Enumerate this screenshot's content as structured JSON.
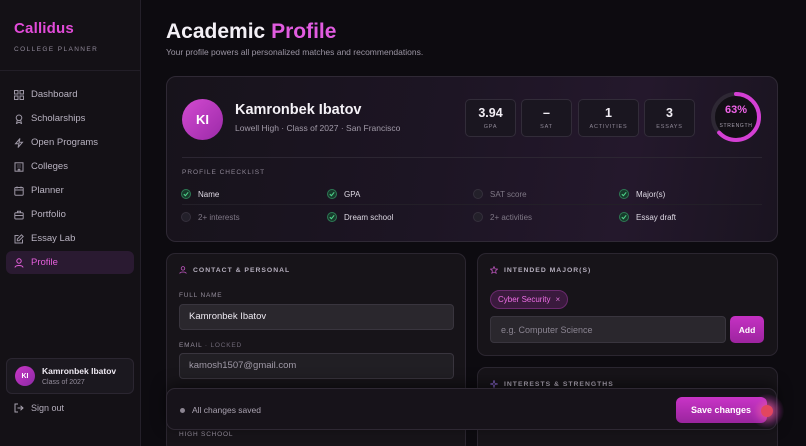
{
  "brand": {
    "name": "Callidus",
    "subtitle": "COLLEGE PLANNER"
  },
  "sidebar": {
    "items": [
      {
        "label": "Dashboard",
        "icon": "grid-icon",
        "active": false
      },
      {
        "label": "Scholarships",
        "icon": "award-icon",
        "active": false
      },
      {
        "label": "Open Programs",
        "icon": "bolt-icon",
        "active": false
      },
      {
        "label": "Colleges",
        "icon": "building-icon",
        "active": false
      },
      {
        "label": "Planner",
        "icon": "calendar-icon",
        "active": false
      },
      {
        "label": "Portfolio",
        "icon": "briefcase-icon",
        "active": false
      },
      {
        "label": "Essay Lab",
        "icon": "edit-icon",
        "active": false
      },
      {
        "label": "Profile",
        "icon": "user-icon",
        "active": true
      }
    ],
    "user": {
      "initials": "KI",
      "name": "Kamronbek Ibatov",
      "class": "Class of 2027"
    },
    "signout": "Sign out"
  },
  "page": {
    "title_main": "Academic",
    "title_accent": "Profile",
    "subtitle": "Your profile powers all personalized matches and recommendations."
  },
  "profile": {
    "initials": "KI",
    "name": "Kamronbek Ibatov",
    "details": "Lowell High · Class of 2027 · San Francisco",
    "stats": [
      {
        "value": "3.94",
        "label": "GPA"
      },
      {
        "value": "–",
        "label": "SAT"
      },
      {
        "value": "1",
        "label": "ACTIVITIES"
      },
      {
        "value": "3",
        "label": "ESSAYS"
      }
    ],
    "strength": {
      "percent_text": "63%",
      "value": 0.63,
      "label": "STRENGTH"
    }
  },
  "checklist": {
    "title": "PROFILE CHECKLIST",
    "items": [
      {
        "label": "Name",
        "done": true
      },
      {
        "label": "GPA",
        "done": true
      },
      {
        "label": "SAT score",
        "done": false
      },
      {
        "label": "Major(s)",
        "done": true
      },
      {
        "label": "2+ interests",
        "done": false
      },
      {
        "label": "Dream school",
        "done": true
      },
      {
        "label": "2+ activities",
        "done": false
      },
      {
        "label": "Essay draft",
        "done": true
      }
    ]
  },
  "contact": {
    "title": "CONTACT & PERSONAL",
    "full_name_label": "FULL NAME",
    "full_name_value": "Kamronbek Ibatov",
    "email_label": "EMAIL",
    "email_locked": "· LOCKED",
    "email_value": "kamosh1507@gmail.com",
    "high_school_label": "HIGH SCHOOL"
  },
  "majors": {
    "title": "INTENDED MAJOR(S)",
    "chips": [
      {
        "label": "Cyber Security",
        "remove": "×"
      }
    ],
    "input_placeholder": "e.g. Computer Science",
    "add_label": "Add"
  },
  "interests": {
    "title": "INTERESTS & STRENGTHS"
  },
  "savebar": {
    "status": "All changes saved",
    "save_label": "Save changes"
  },
  "colors": {
    "accent": "#e15ce0",
    "success": "#2d7a54",
    "background": "#0d0b10"
  }
}
